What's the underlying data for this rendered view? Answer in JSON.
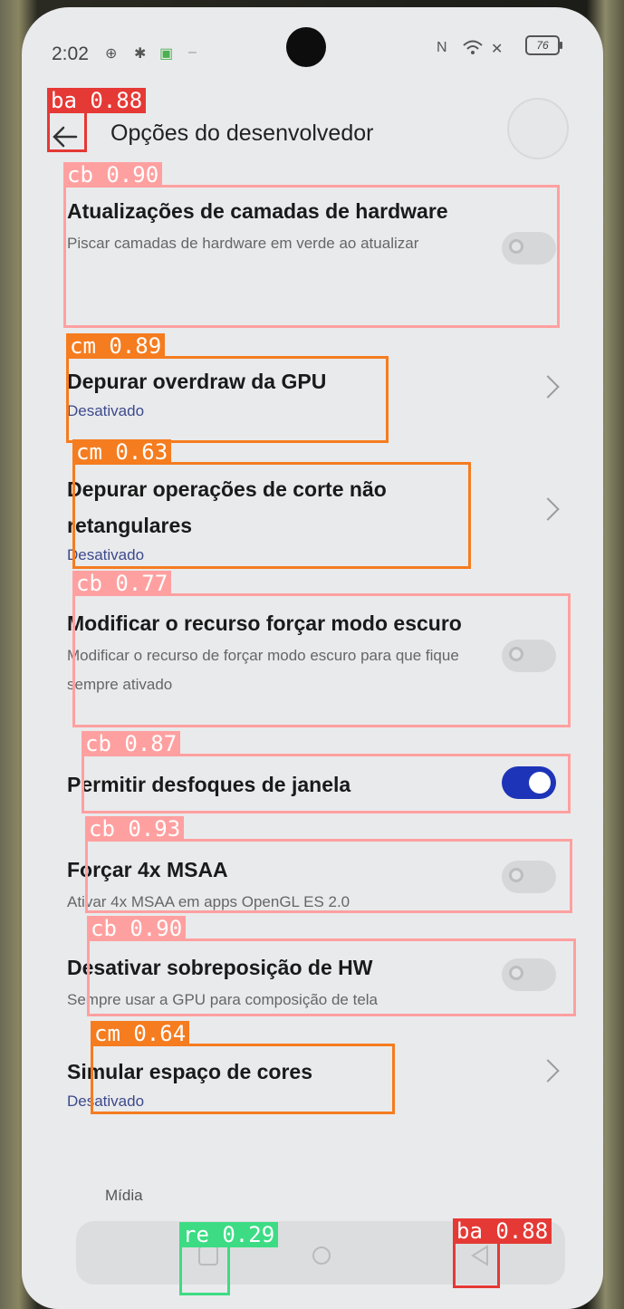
{
  "status": {
    "time": "2:02",
    "battery": "76"
  },
  "header": {
    "title": "Opções do desenvolvedor"
  },
  "rows": [
    {
      "title": "Atualizações de camadas de hardware",
      "subtitle": "Piscar camadas de hardware em verde ao atualizar",
      "control": "toggle",
      "on": false
    },
    {
      "title": "Depurar overdraw da GPU",
      "value": "Desativado",
      "control": "chevron"
    },
    {
      "title": "Depurar operações de corte não retangulares",
      "value": "Desativado",
      "control": "chevron"
    },
    {
      "title": "Modificar o recurso forçar modo escuro",
      "subtitle": "Modificar o recurso de forçar modo escuro para que fique sempre ativado",
      "control": "toggle",
      "on": false
    },
    {
      "title": "Permitir desfoques de janela",
      "control": "toggle",
      "on": true
    },
    {
      "title": "Forçar 4x MSAA",
      "subtitle": "Ativar 4x MSAA em apps OpenGL ES 2.0",
      "control": "toggle",
      "on": false
    },
    {
      "title": "Desativar sobreposição de HW",
      "subtitle": "Sempre usar a GPU para composição de tela",
      "control": "toggle",
      "on": false
    },
    {
      "title": "Simular espaço de cores",
      "value": "Desativado",
      "control": "chevron"
    }
  ],
  "section_label": "Mídia",
  "detections": [
    {
      "label": "ba 0.88",
      "color": "#e53935"
    },
    {
      "label": "cb 0.90",
      "color": "#ffa0a0"
    },
    {
      "label": "cm 0.89",
      "color": "#f57c1f"
    },
    {
      "label": "cm 0.63",
      "color": "#f57c1f"
    },
    {
      "label": "cb 0.77",
      "color": "#ffa0a0"
    },
    {
      "label": "cb 0.87",
      "color": "#ffa0a0"
    },
    {
      "label": "cb 0.93",
      "color": "#ffa0a0"
    },
    {
      "label": "cb 0.90",
      "color": "#ffa0a0"
    },
    {
      "label": "cm 0.64",
      "color": "#f57c1f"
    },
    {
      "label": "re 0.29",
      "color": "#3ddc84"
    },
    {
      "label": "ba 0.88",
      "color": "#e53935"
    }
  ]
}
